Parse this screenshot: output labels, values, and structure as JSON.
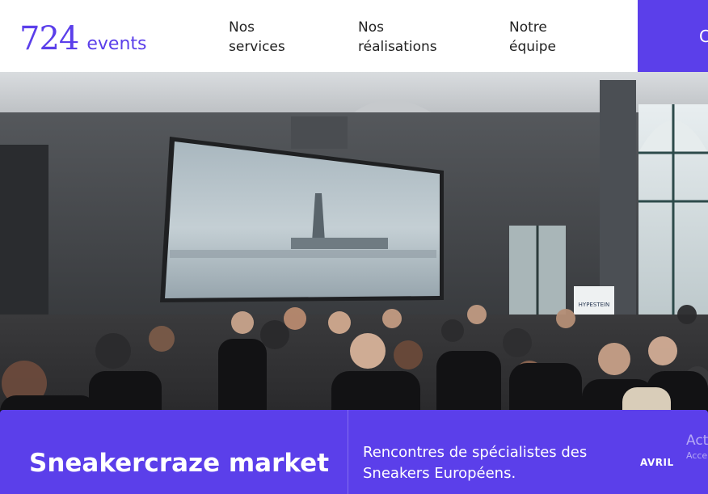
{
  "header": {
    "logo_number": "724",
    "logo_word": "events",
    "nav": [
      {
        "line1": "Nos",
        "line2": "services"
      },
      {
        "line1": "Nos",
        "line2": "réalisations"
      },
      {
        "line1": "Notre",
        "line2": "équipe"
      }
    ],
    "contact_label": "C"
  },
  "hero": {
    "screen_sign": "HYPESTEIN"
  },
  "event": {
    "title": "Sneakercraze market",
    "description": "Rencontres de spécialistes des Sneakers Européens.",
    "month": "AVRIL"
  },
  "system_overlay": {
    "line1": "Act",
    "line2": "Acce"
  },
  "colors": {
    "accent": "#5B3FEA",
    "header_bg": "#FFFFFF",
    "text_dark": "#222222"
  }
}
